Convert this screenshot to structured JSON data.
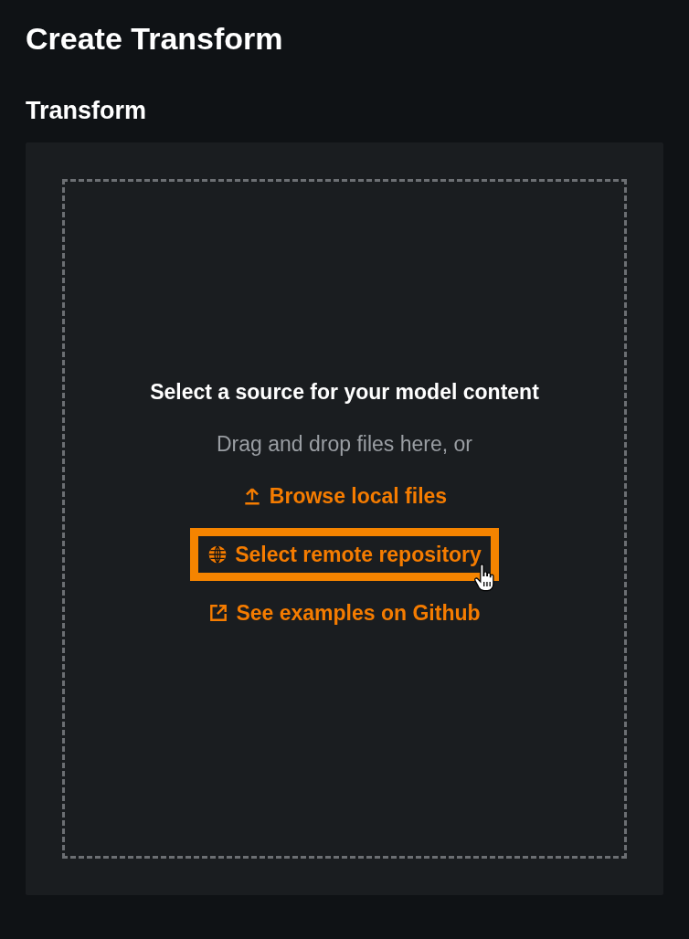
{
  "page": {
    "title": "Create Transform"
  },
  "section": {
    "title": "Transform"
  },
  "dropzone": {
    "heading": "Select a source for your model content",
    "hint": "Drag and drop files here, or",
    "links": [
      {
        "label": "Browse local files",
        "kind": "upload",
        "highlighted": false
      },
      {
        "label": "Select remote repository",
        "kind": "remote",
        "highlighted": true
      },
      {
        "label": "See examples on Github",
        "kind": "external",
        "highlighted": false
      }
    ]
  }
}
